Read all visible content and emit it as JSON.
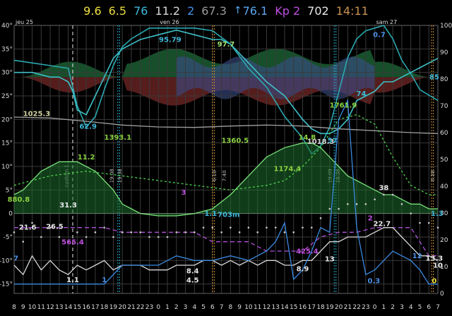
{
  "header": {
    "items": [
      {
        "text": "9.6",
        "color": "#f0e040",
        "arrow": ""
      },
      {
        "text": "6.5",
        "color": "#e8d840",
        "arrow": ""
      },
      {
        "text": "76",
        "color": "#3fb8d8",
        "arrow": ""
      },
      {
        "text": "11.2",
        "color": "#d8d8d8",
        "arrow": ""
      },
      {
        "text": "2",
        "color": "#4a90e8",
        "arrow": ""
      },
      {
        "text": "67.3",
        "color": "#9a9a9a",
        "arrow": ""
      },
      {
        "text": "76.1",
        "color": "#5aa8f0",
        "arrow": "↑"
      },
      {
        "text": "Kp 2",
        "color": "#c050e0",
        "arrow": ""
      },
      {
        "text": "702",
        "color": "#e8e8e8",
        "arrow": ""
      },
      {
        "text": "14:11",
        "color": "#c89050",
        "arrow": ""
      }
    ]
  },
  "chart_data": {
    "type": "line",
    "day_labels": [
      {
        "text": "jeu 25",
        "x_hour": 8
      },
      {
        "text": "ven 26",
        "x_hour": 24
      },
      {
        "text": "sam 27",
        "x_hour": 48
      }
    ],
    "x_ticks": [
      "8",
      "9",
      "10",
      "11",
      "12",
      "13",
      "14",
      "15",
      "16",
      "17",
      "18",
      "19",
      "20",
      "21",
      "22",
      "23",
      "0",
      "1",
      "2",
      "3",
      "4",
      "5",
      "6",
      "7",
      "8",
      "9",
      "10",
      "11",
      "12",
      "13",
      "14",
      "15",
      "16",
      "17",
      "18",
      "19",
      "20",
      "21",
      "22",
      "23",
      "0",
      "1",
      "2",
      "3",
      "4",
      "5",
      "6",
      "7"
    ],
    "y_left_ticks": [
      "40°",
      "35°",
      "30°",
      "25°",
      "20°",
      "15°",
      "10°",
      "5°",
      "0",
      "-5°",
      "-10°",
      "-15°"
    ],
    "y_left_range": [
      -17,
      40
    ],
    "y_right_ticks": [
      "100",
      "90",
      "80",
      "70",
      "60",
      "50",
      "40",
      "30",
      "20",
      "10",
      "0"
    ],
    "y_right_range": [
      0,
      100
    ],
    "event_lines": {
      "white_dashed_hour": 14.5,
      "cyan_hours": [
        19.5,
        19.7,
        43.5,
        43.7
      ],
      "orange_hours": [
        30.0,
        30.2,
        54.3,
        54.5
      ],
      "vertical_texts": [
        {
          "text": "custom 1",
          "hour": 14.0
        },
        {
          "text": "19:08",
          "hour": 19.0
        },
        {
          "text": "19:38",
          "hour": 19.9
        },
        {
          "text": "6:10",
          "hour": 30.4
        },
        {
          "text": "7:40",
          "hour": 31.5
        },
        {
          "text": "19:09",
          "hour": 43.2
        },
        {
          "text": "19:36",
          "hour": 44.1
        },
        {
          "text": "6:38",
          "hour": 54.6
        }
      ]
    },
    "series": [
      {
        "name": "humidity",
        "axis": "right",
        "color": "#2aa8b0",
        "x": [
          8,
          10,
          12,
          14,
          15,
          16,
          17,
          18,
          19,
          20,
          21,
          22,
          23,
          24,
          26,
          28,
          30,
          32,
          34,
          36,
          38,
          40,
          41,
          42,
          43,
          44,
          45,
          46,
          47,
          48,
          49,
          50,
          51,
          52,
          53,
          54,
          55
        ],
        "y": [
          87,
          86,
          85,
          84,
          70,
          62,
          66,
          76,
          85,
          92,
          95,
          97,
          99,
          99,
          99,
          99,
          98,
          93,
          84,
          77,
          66,
          58,
          52,
          55,
          62,
          75,
          88,
          95,
          98,
          99,
          100,
          95,
          87,
          82,
          76,
          74,
          72
        ]
      },
      {
        "name": "temperature",
        "axis": "left",
        "color": "#3ec0c8",
        "x": [
          8,
          10,
          12,
          13,
          14,
          14.5,
          15,
          16,
          17,
          18,
          19,
          20,
          21,
          22,
          24,
          26,
          28,
          30,
          31,
          32,
          34,
          36,
          38,
          40,
          41,
          42,
          43,
          44,
          45,
          46,
          47,
          48,
          49,
          50,
          51,
          52,
          53,
          54,
          55
        ],
        "y": [
          30,
          30,
          29,
          29,
          28,
          26,
          22,
          21,
          25,
          29,
          33,
          35,
          36,
          37,
          38,
          39,
          38,
          37,
          37,
          36,
          32,
          28,
          25,
          20,
          18,
          17,
          17,
          18,
          20,
          24,
          25,
          26,
          28,
          28,
          29,
          30,
          31,
          32,
          33
        ]
      },
      {
        "name": "dew_point",
        "axis": "left",
        "color": "#7ae07a",
        "x": [
          8,
          9,
          10,
          11,
          12,
          13,
          14,
          15,
          16,
          17,
          18,
          19,
          20,
          21,
          22,
          24,
          26,
          28,
          30,
          32,
          34,
          36,
          38,
          40,
          41,
          42,
          43,
          44,
          45,
          46,
          47,
          48,
          49,
          50,
          51,
          52,
          53,
          54,
          55
        ],
        "y": [
          4,
          5,
          7,
          9,
          10,
          11,
          11,
          11,
          10,
          9,
          7,
          5,
          2,
          1,
          0,
          -0.5,
          -0.5,
          0,
          1,
          4,
          8,
          12,
          14,
          15,
          15,
          14,
          12,
          10,
          8,
          7,
          6,
          5,
          4,
          4,
          3,
          2,
          2,
          1,
          1
        ]
      },
      {
        "name": "pressure_gray",
        "axis": "left",
        "color": "#a0a0a0",
        "x": [
          8,
          12,
          16,
          20,
          24,
          28,
          32,
          36,
          40,
          44,
          48,
          52,
          55
        ],
        "y": [
          20.5,
          20.3,
          19.6,
          18.8,
          18.4,
          18.3,
          18.6,
          18.8,
          18.6,
          18.0,
          17.6,
          17.2,
          17.0
        ]
      },
      {
        "name": "kp",
        "axis": "left",
        "color": "#b050d8",
        "x": [
          8,
          10,
          12,
          14,
          16,
          18,
          20,
          22,
          24,
          26,
          28,
          30,
          32,
          34,
          36,
          38,
          40,
          42,
          44,
          46,
          48,
          50,
          52,
          54,
          55
        ],
        "y": [
          -3,
          -3,
          -3,
          -3,
          -3,
          -3,
          -4,
          -4,
          -4,
          -4,
          -4,
          -6,
          -6,
          -6,
          -8,
          -8,
          -8,
          -5,
          -4,
          -4,
          -3,
          -3,
          -3,
          -9,
          -9
        ]
      },
      {
        "name": "wind",
        "axis": "left",
        "color": "#d8d8d8",
        "x": [
          8,
          9,
          10,
          11,
          12,
          13,
          14,
          15,
          16,
          17,
          18,
          19,
          20,
          21,
          22,
          23,
          24,
          25,
          26,
          27,
          28,
          29,
          30,
          31,
          32,
          33,
          34,
          35,
          36,
          37,
          38,
          39,
          40,
          41,
          42,
          43,
          44,
          45,
          46,
          47,
          48,
          49,
          50,
          51,
          52,
          53,
          54,
          55
        ],
        "y": [
          -11,
          -13,
          -9,
          -12,
          -10,
          -12,
          -13,
          -11,
          -12,
          -11,
          -10,
          -12,
          -11,
          -11,
          -11,
          -12,
          -12,
          -12,
          -11,
          -11,
          -11,
          -10,
          -10,
          -11,
          -10,
          -11,
          -10,
          -11,
          -10,
          -10,
          -11,
          -11,
          -10,
          -10,
          -8,
          -6,
          -6,
          -5,
          -5,
          -5,
          -4,
          -3,
          -3,
          -5,
          -7,
          -9,
          -9,
          -10
        ]
      },
      {
        "name": "pressure_green_dotted",
        "axis": "left",
        "color": "#4cd04c",
        "x": [
          8,
          12,
          16,
          20,
          24,
          28,
          32,
          36,
          38,
          40,
          42,
          44,
          46,
          48,
          50,
          52,
          54,
          55
        ],
        "y": [
          6,
          8,
          9,
          8,
          7,
          6,
          5,
          6,
          7,
          10,
          14,
          20,
          21,
          19,
          12,
          6,
          4,
          4
        ]
      },
      {
        "name": "precip_blue",
        "axis": "left",
        "color": "#3a8ae0",
        "x": [
          8,
          10,
          12,
          14,
          16,
          18,
          20,
          22,
          24,
          26,
          28,
          30,
          32,
          34,
          36,
          37,
          38,
          39,
          40,
          41,
          42,
          43,
          44,
          45,
          46,
          47,
          48,
          49,
          50,
          51,
          52,
          53,
          54,
          55
        ],
        "y": [
          -15,
          -15,
          -15,
          -15,
          -15,
          -15,
          -11,
          -11,
          -11,
          -9,
          -10,
          -10,
          -9,
          -10,
          -8,
          -6,
          -2,
          -14,
          -12,
          -8,
          -3,
          -4,
          20,
          24,
          -3,
          -13,
          -12,
          -10,
          -8,
          -9,
          -10,
          -12,
          -15,
          -15
        ]
      }
    ],
    "labels": [
      {
        "text": "95.79",
        "hour": 25.3,
        "y": 36.5,
        "color": "#3fb8d8"
      },
      {
        "text": "97.7",
        "hour": 31.5,
        "y": 35.5,
        "color": "#a0e070"
      },
      {
        "text": "85",
        "hour": 54.6,
        "y": 28.5,
        "color": "#3fb8d8"
      },
      {
        "text": "0.7",
        "hour": 48.5,
        "y": 37.5,
        "color": "#4a90e8"
      },
      {
        "text": "62.9",
        "hour": 16.2,
        "y": 18.0,
        "color": "#3fb8d8"
      },
      {
        "text": "1025.3",
        "hour": 10.5,
        "y": 20.7,
        "color": "#d0d0a0"
      },
      {
        "text": "1761.9",
        "hour": 44.5,
        "y": 22.5,
        "color": "#8ad040"
      },
      {
        "text": "74",
        "hour": 46.5,
        "y": 25.0,
        "color": "#3fb8d8"
      },
      {
        "text": "1393.1",
        "hour": 19.5,
        "y": 15.7,
        "color": "#8ad040"
      },
      {
        "text": "1360.5",
        "hour": 32.5,
        "y": 15.0,
        "color": "#8ad040"
      },
      {
        "text": "14.8",
        "hour": 40.5,
        "y": 15.7,
        "color": "#8ad040"
      },
      {
        "text": "1018.3",
        "hour": 42.0,
        "y": 14.8,
        "color": "#d0d0d0"
      },
      {
        "text": "57",
        "hour": 43.3,
        "y": 15.0,
        "color": "#3fb8d8"
      },
      {
        "text": "11.2",
        "hour": 16.0,
        "y": 11.5,
        "color": "#8ad040"
      },
      {
        "text": "1174.4",
        "hour": 38.3,
        "y": 9.0,
        "color": "#8ad040"
      },
      {
        "text": "880.8",
        "hour": 8.5,
        "y": 2.5,
        "color": "#8ad040"
      },
      {
        "text": "31.3",
        "hour": 14.0,
        "y": 1.3,
        "color": "#e8e8e8"
      },
      {
        "text": "3",
        "hour": 26.8,
        "y": 4.0,
        "color": "#c050e0"
      },
      {
        "text": "38",
        "hour": 49.0,
        "y": 5.0,
        "color": "#e8e8e8"
      },
      {
        "text": "1.1",
        "hour": 29.8,
        "y": -0.5,
        "color": "#3fb8d8"
      },
      {
        "text": "703m",
        "hour": 31.8,
        "y": -0.7,
        "color": "#3fb8d8"
      },
      {
        "text": "1.3",
        "hour": 54.9,
        "y": -0.5,
        "color": "#3fb8d8"
      },
      {
        "text": "21.6",
        "hour": 9.5,
        "y": -3.4,
        "color": "#e8e8e8"
      },
      {
        "text": "26.5",
        "hour": 12.5,
        "y": -3.3,
        "color": "#e8e8e8"
      },
      {
        "text": "2",
        "hour": 47.5,
        "y": -1.5,
        "color": "#c050e0"
      },
      {
        "text": "22.7",
        "hour": 48.8,
        "y": -2.7,
        "color": "#e8e8e8"
      },
      {
        "text": "565.4",
        "hour": 14.5,
        "y": -6.6,
        "color": "#c050e0"
      },
      {
        "text": "425.4",
        "hour": 40.5,
        "y": -8.5,
        "color": "#c050e0"
      },
      {
        "text": "13",
        "hour": 43.0,
        "y": -10.2,
        "color": "#e8e8e8"
      },
      {
        "text": "8.9",
        "hour": 40.0,
        "y": -12.3,
        "color": "#e8e8e8"
      },
      {
        "text": "8.4",
        "hour": 27.8,
        "y": -12.7,
        "color": "#e8e8e8"
      },
      {
        "text": "4.5",
        "hour": 27.8,
        "y": -14.7,
        "color": "#e8e8e8"
      },
      {
        "text": "7",
        "hour": 8.2,
        "y": -10.0,
        "color": "#4a90e8"
      },
      {
        "text": "1.1",
        "hour": 14.5,
        "y": -14.6,
        "color": "#e8e8e8"
      },
      {
        "text": "1",
        "hour": 18.0,
        "y": -14.6,
        "color": "#4a90e8"
      },
      {
        "text": "12",
        "hour": 52.7,
        "y": -9.5,
        "color": "#4a90e8"
      },
      {
        "text": "13.3",
        "hour": 54.6,
        "y": -10.0,
        "color": "#e8e8e8"
      },
      {
        "text": "10",
        "hour": 55.0,
        "y": -11.5,
        "color": "#e8e8e8"
      },
      {
        "text": "0",
        "hour": 54.6,
        "y": -14.8,
        "color": "#f0e040"
      },
      {
        "text": "0.3",
        "hour": 47.9,
        "y": -14.8,
        "color": "#4a90e8"
      }
    ]
  }
}
